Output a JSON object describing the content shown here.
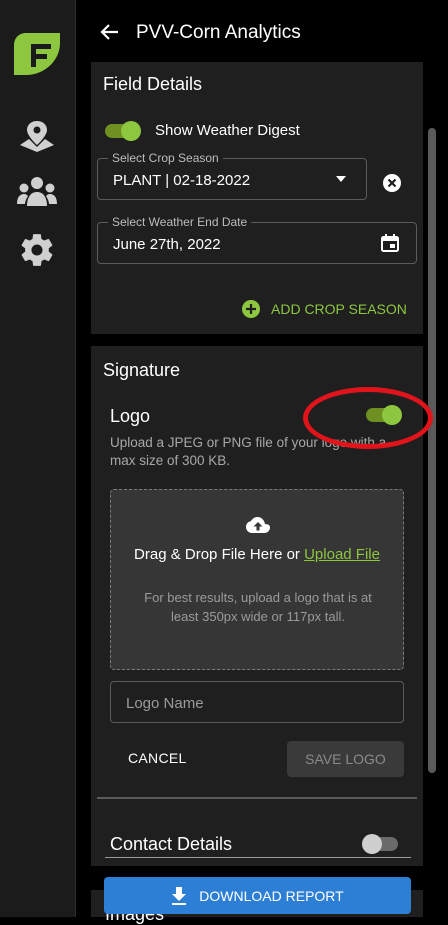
{
  "app": {
    "title": "PVV-Corn Analytics"
  },
  "rail": {
    "icons": [
      "brand-logo-icon",
      "map-pin-icon",
      "group-icon",
      "settings-gear-icon"
    ]
  },
  "field_details": {
    "title": "Field Details",
    "weather_digest_label": "Show Weather Digest",
    "weather_digest_on": true,
    "crop_season": {
      "label": "Select Crop Season",
      "value": "PLANT | 02-18-2022"
    },
    "weather_end_date": {
      "label": "Select Weather End Date",
      "value": "June 27th, 2022"
    },
    "add_crop_season": "ADD CROP SEASON"
  },
  "signature": {
    "title": "Signature",
    "logo_heading": "Logo",
    "logo_on": true,
    "logo_desc": "Upload a JPEG or PNG file of your logo with a max size of 300 KB.",
    "drop_text": "Drag & Drop File Here or",
    "upload_link": "Upload File",
    "hint": "For best results, upload a logo that is at least 350px wide or 117px tall.",
    "logo_name_placeholder": "Logo Name",
    "cancel": "CANCEL",
    "save": "SAVE LOGO",
    "contact_heading": "Contact Details",
    "contact_on": false
  },
  "partial_section": "Images",
  "download": "DOWNLOAD REPORT",
  "colors": {
    "accent_green": "#8dc63f",
    "button_blue": "#2d7fd6",
    "annotation_red": "#e0141a"
  }
}
